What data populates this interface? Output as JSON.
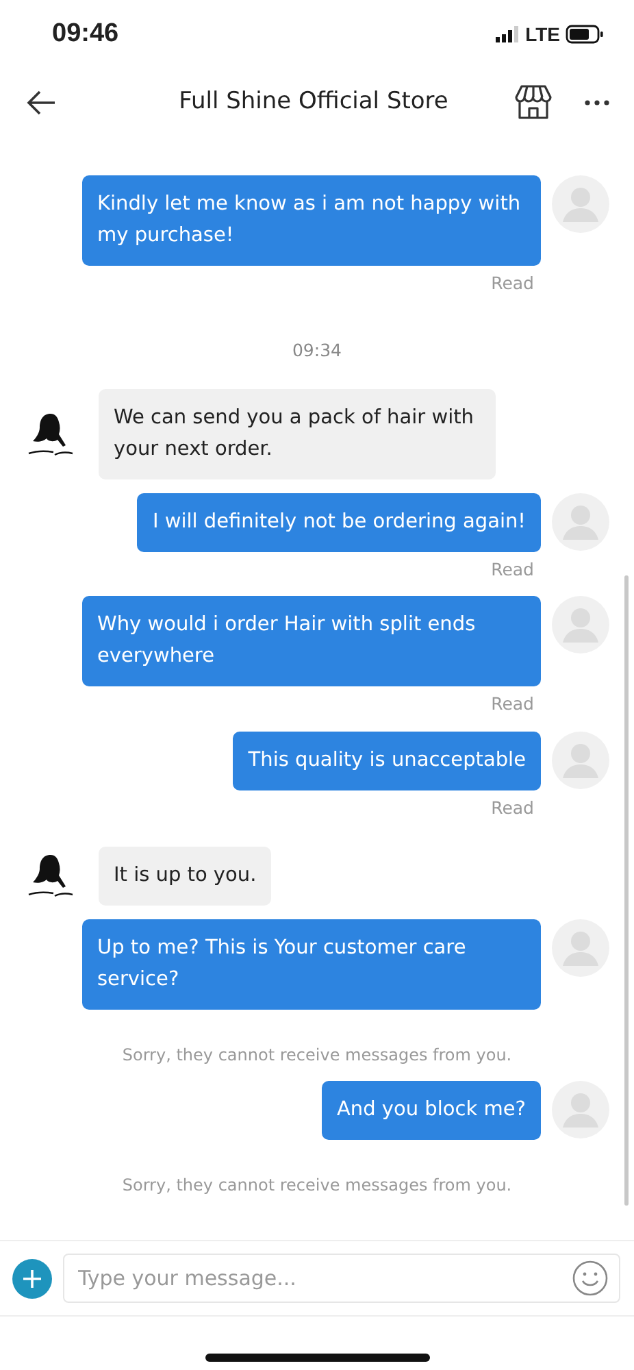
{
  "status_bar": {
    "time": "09:46",
    "network": "LTE"
  },
  "header": {
    "title": "Full Shine Official Store"
  },
  "messages": [
    {
      "kind": "sent",
      "text": "Kindly let me know as i am not happy with my purchase!",
      "status": "Read"
    },
    {
      "kind": "time",
      "text": "09:34"
    },
    {
      "kind": "received",
      "text": "We can send you a pack of hair with your next order."
    },
    {
      "kind": "sent",
      "text": "I will definitely not be ordering again!",
      "status": "Read"
    },
    {
      "kind": "sent",
      "text": "Why would i order Hair with split ends everywhere",
      "status": "Read"
    },
    {
      "kind": "sent",
      "text": "This quality is unacceptable",
      "status": "Read"
    },
    {
      "kind": "received",
      "text": "It is up to you."
    },
    {
      "kind": "sent",
      "text": "Up to me? This is Your customer care service?"
    },
    {
      "kind": "notice",
      "text": "Sorry, they cannot receive messages from you."
    },
    {
      "kind": "sent",
      "text": "And you block me?"
    },
    {
      "kind": "notice",
      "text": "Sorry, they cannot receive messages from you."
    }
  ],
  "composer": {
    "placeholder": "Type your message..."
  }
}
